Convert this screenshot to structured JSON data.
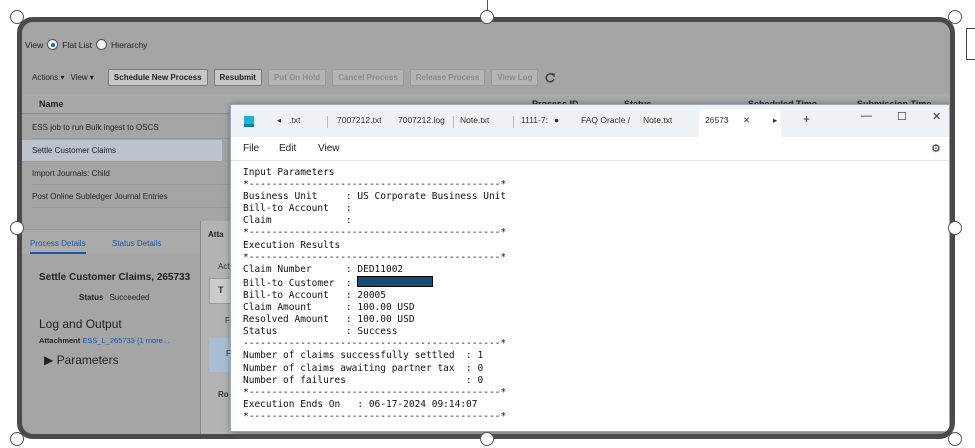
{
  "app": {
    "view_label": "View",
    "flat_list_label": "Flat List",
    "hierarchy_label": "Hierarchy",
    "actions_label": "Actions ▾",
    "view_menu_label": "View ▾",
    "buttons": [
      "Schedule New Process",
      "Resubmit",
      "Put On Hold",
      "Cancel Process",
      "Release Process",
      "View Log"
    ],
    "refresh_icon": "refresh-icon",
    "columns": [
      "Name",
      "Process ID",
      "Status",
      "Scheduled Time",
      "Submission Time"
    ],
    "rows": [
      "ESS job to run Bulk ingest to OSCS",
      "Settle Customer Claims",
      "Import Journals: Child",
      "Post Online Subledger Journal Entries"
    ],
    "detail_tabs": [
      "Process Details",
      "Status Details"
    ],
    "detail_title": "Settle Customer Claims, 265733",
    "status_label": "Status",
    "status_value": "Succeeded",
    "log_title": "Log and Output",
    "attachment_label": "Attachment",
    "attachment_link": "ESS_L_265733 (1 more...",
    "parameters_label": "Parameters",
    "attach_dialog_title": "Atta",
    "attach_dialog_act": "Act",
    "attach_dialog_t": "T",
    "attach_dialog_f1": "F",
    "attach_dialog_f2": "F",
    "attach_dialog_ro": "Ro"
  },
  "notepad": {
    "tabs": [
      ".txt",
      "7007212.txt",
      "7007212.log",
      "Note.txt",
      "1111-7:",
      "FAQ Oracle /",
      "Note.txt",
      "26573"
    ],
    "nav_left": "◂",
    "nav_right": "▸",
    "close_tab": "✕",
    "new_tab": "+",
    "minimize": "—",
    "maximize": "☐",
    "close": "✕",
    "menu": [
      "File",
      "Edit",
      "View"
    ],
    "settings_icon": "⚙",
    "lines": [
      "Input Parameters",
      "*--------------------------------------------*",
      "Business Unit     : US Corporate Business Unit",
      "Bill-to Account   :",
      "Claim             :",
      "*--------------------------------------------*",
      "Execution Results",
      "*--------------------------------------------*",
      "Claim Number      : DED11002",
      "Bill-to Customer  : ",
      "Bill-to Account   : 20005",
      "Claim Amount      : 100.00 USD",
      "Resolved Amount   : 100.00 USD",
      "Status            : Success",
      "---------------------------------------------*",
      "Number of claims successfully settled  : 1",
      "Number of claims awaiting partner tax  : 0",
      "Number of failures                     : 0",
      "*--------------------------------------------*",
      "Execution Ends On   : 06-17-2024 09:14:07",
      "*--------------------------------------------*"
    ]
  }
}
